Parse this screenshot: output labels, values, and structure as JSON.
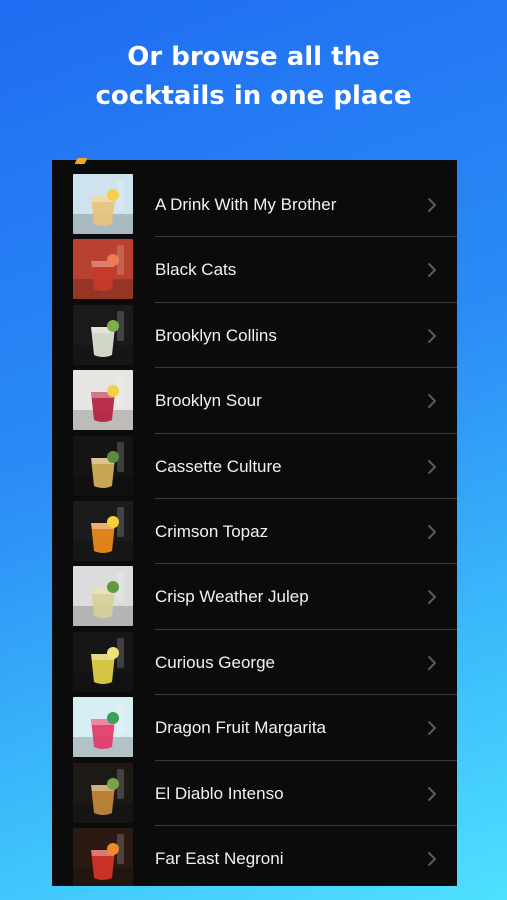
{
  "headline": {
    "line1": "Or browse all the",
    "line2": "cocktails in one place"
  },
  "cocktails": [
    {
      "name": "A Drink With My Brother",
      "thumb_bg": "#cfe3ee",
      "glass": "#e9c27a",
      "garnish": "#f2d04a"
    },
    {
      "name": "Black Cats",
      "thumb_bg": "#b8412f",
      "glass": "#c83a2a",
      "garnish": "#f07a55"
    },
    {
      "name": "Brooklyn Collins",
      "thumb_bg": "#1a1a1a",
      "glass": "#dfe8d6",
      "garnish": "#7db04a"
    },
    {
      "name": "Brooklyn Sour",
      "thumb_bg": "#e8e6e2",
      "glass": "#b31f3c",
      "garnish": "#f3d04b"
    },
    {
      "name": "Cassette Culture",
      "thumb_bg": "#141414",
      "glass": "#d9b35a",
      "garnish": "#5f8b3a"
    },
    {
      "name": "Crimson Topaz",
      "thumb_bg": "#1b1b1b",
      "glass": "#f28c1c",
      "garnish": "#f7d040"
    },
    {
      "name": "Crisp Weather Julep",
      "thumb_bg": "#dcdcdc",
      "glass": "#d7cf9a",
      "garnish": "#5d9b3c"
    },
    {
      "name": "Curious George",
      "thumb_bg": "#161616",
      "glass": "#e6d54a",
      "garnish": "#f2e07a"
    },
    {
      "name": "Dragon Fruit Margarita",
      "thumb_bg": "#d8eef3",
      "glass": "#e23a67",
      "garnish": "#3aa05a"
    },
    {
      "name": "El Diablo Intenso",
      "thumb_bg": "#1d1a16",
      "glass": "#c58a3a",
      "garnish": "#7aa24a"
    },
    {
      "name": "Far East Negroni",
      "thumb_bg": "#2a1a12",
      "glass": "#d6342a",
      "garnish": "#f08a2a"
    }
  ]
}
